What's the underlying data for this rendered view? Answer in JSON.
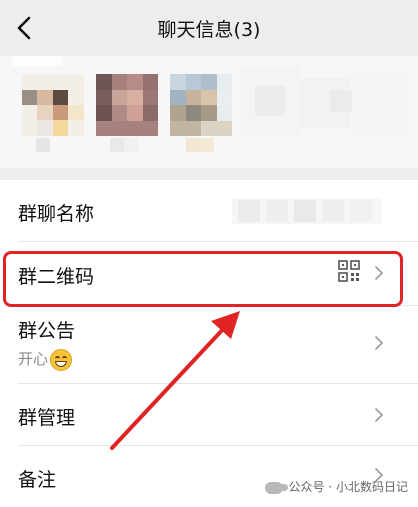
{
  "header": {
    "title": "聊天信息(3)",
    "back_icon": "chevron-left-icon"
  },
  "members": {
    "avatars": [
      "avatar-1",
      "avatar-2",
      "avatar-3"
    ]
  },
  "list": {
    "group_name_label": "群聊名称",
    "qrcode_label": "群二维码",
    "qrcode_icon": "qr-code-icon",
    "notice_label": "群公告",
    "notice_preview": "开心",
    "manage_label": "群管理",
    "remark_label": "备注"
  },
  "annotation": {
    "highlight_color": "#e02424"
  },
  "watermark": {
    "text": "公众号 · 小北数码日记"
  }
}
